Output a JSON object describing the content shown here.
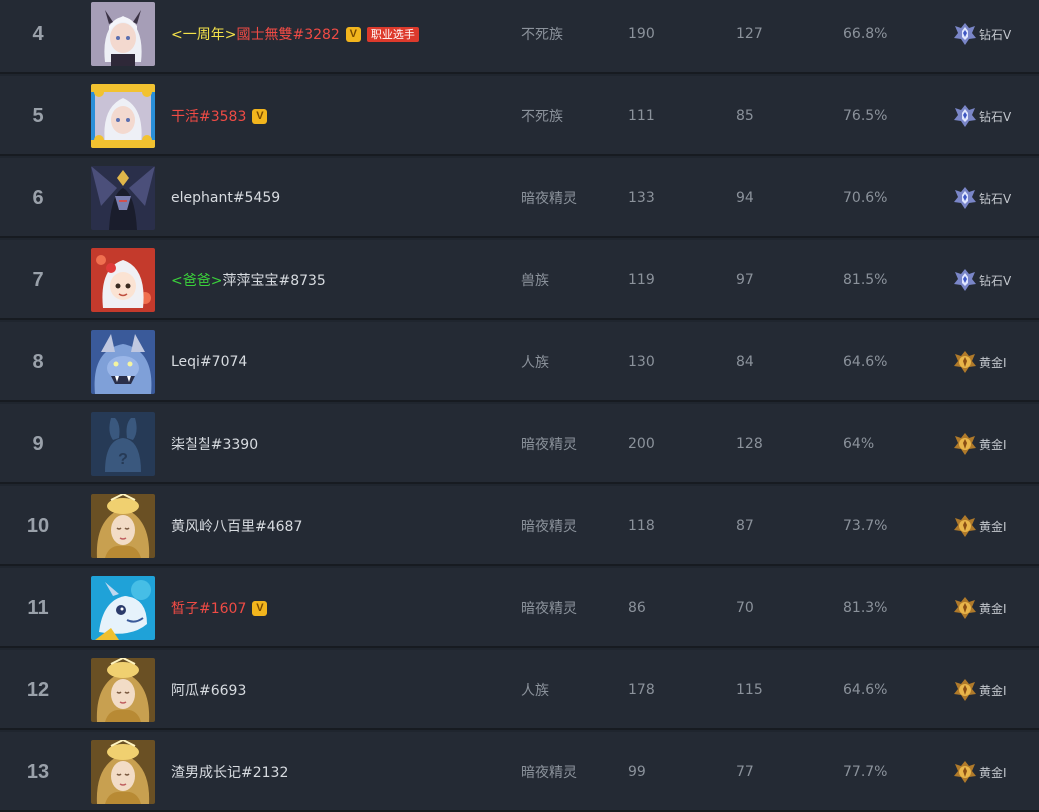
{
  "rows": [
    {
      "rank": "4",
      "prefix": "<一周年>",
      "prefix_style": "yellow",
      "name": "國士無雙#3282",
      "name_style": "red",
      "vip": true,
      "pro": "职业选手",
      "race": "不死族",
      "games": "190",
      "wins": "127",
      "rate": "66.8%",
      "tier": "钻石V",
      "tier_icon": "diamond-tier-icon",
      "avatar": "avatar-white-hair-catgirl"
    },
    {
      "rank": "5",
      "prefix": "",
      "prefix_style": "",
      "name": "干活#3583",
      "name_style": "red",
      "vip": true,
      "pro": "",
      "race": "不死族",
      "games": "111",
      "wins": "85",
      "rate": "76.5%",
      "tier": "钻石V",
      "tier_icon": "diamond-tier-icon",
      "avatar": "avatar-white-hair-framed"
    },
    {
      "rank": "6",
      "prefix": "",
      "prefix_style": "",
      "name": "elephant#5459",
      "name_style": "normal",
      "vip": false,
      "pro": "",
      "race": "暗夜精灵",
      "games": "133",
      "wins": "94",
      "rate": "70.6%",
      "tier": "钻石V",
      "tier_icon": "diamond-tier-icon",
      "avatar": "avatar-dark-knight"
    },
    {
      "rank": "7",
      "prefix": "<爸爸>",
      "prefix_style": "green",
      "name": "萍萍宝宝#8735",
      "name_style": "normal",
      "vip": false,
      "pro": "",
      "race": "兽族",
      "games": "119",
      "wins": "97",
      "rate": "81.5%",
      "tier": "钻石V",
      "tier_icon": "diamond-tier-icon",
      "avatar": "avatar-chibi-girl"
    },
    {
      "rank": "8",
      "prefix": "",
      "prefix_style": "",
      "name": "Leqi#7074",
      "name_style": "normal",
      "vip": false,
      "pro": "",
      "race": "人族",
      "games": "130",
      "wins": "84",
      "rate": "64.6%",
      "tier": "黄金I",
      "tier_icon": "gold-tier-icon",
      "avatar": "avatar-blue-beast"
    },
    {
      "rank": "9",
      "prefix": "",
      "prefix_style": "",
      "name": "柒칠칠#3390",
      "name_style": "normal",
      "vip": false,
      "pro": "",
      "race": "暗夜精灵",
      "games": "200",
      "wins": "128",
      "rate": "64%",
      "tier": "黄金I",
      "tier_icon": "gold-tier-icon",
      "avatar": "avatar-placeholder-rabbit"
    },
    {
      "rank": "10",
      "prefix": "",
      "prefix_style": "",
      "name": "黄风岭八百里#4687",
      "name_style": "normal",
      "vip": false,
      "pro": "",
      "race": "暗夜精灵",
      "games": "118",
      "wins": "87",
      "rate": "73.7%",
      "tier": "黄金I",
      "tier_icon": "gold-tier-icon",
      "avatar": "avatar-golden-priestess"
    },
    {
      "rank": "11",
      "prefix": "",
      "prefix_style": "",
      "name": "皙子#1607",
      "name_style": "red",
      "vip": true,
      "pro": "",
      "race": "暗夜精灵",
      "games": "86",
      "wins": "70",
      "rate": "81.3%",
      "tier": "黄金I",
      "tier_icon": "gold-tier-icon",
      "avatar": "avatar-blue-dragon"
    },
    {
      "rank": "12",
      "prefix": "",
      "prefix_style": "",
      "name": "阿瓜#6693",
      "name_style": "normal",
      "vip": false,
      "pro": "",
      "race": "人族",
      "games": "178",
      "wins": "115",
      "rate": "64.6%",
      "tier": "黄金I",
      "tier_icon": "gold-tier-icon",
      "avatar": "avatar-golden-priestess"
    },
    {
      "rank": "13",
      "prefix": "",
      "prefix_style": "",
      "name": "渣男成长记#2132",
      "name_style": "normal",
      "vip": false,
      "pro": "",
      "race": "暗夜精灵",
      "games": "99",
      "wins": "77",
      "rate": "77.7%",
      "tier": "黄金I",
      "tier_icon": "gold-tier-icon",
      "avatar": "avatar-golden-priestess"
    }
  ],
  "vip_label": "V",
  "colors": {
    "background": "#242a34",
    "divider": "#171b21",
    "red_name": "#ef4b45",
    "prefix_yellow": "#f4e24a",
    "prefix_green": "#3bd13b",
    "vip_badge": "#f2b51d",
    "pro_badge": "#dd3a2c"
  }
}
